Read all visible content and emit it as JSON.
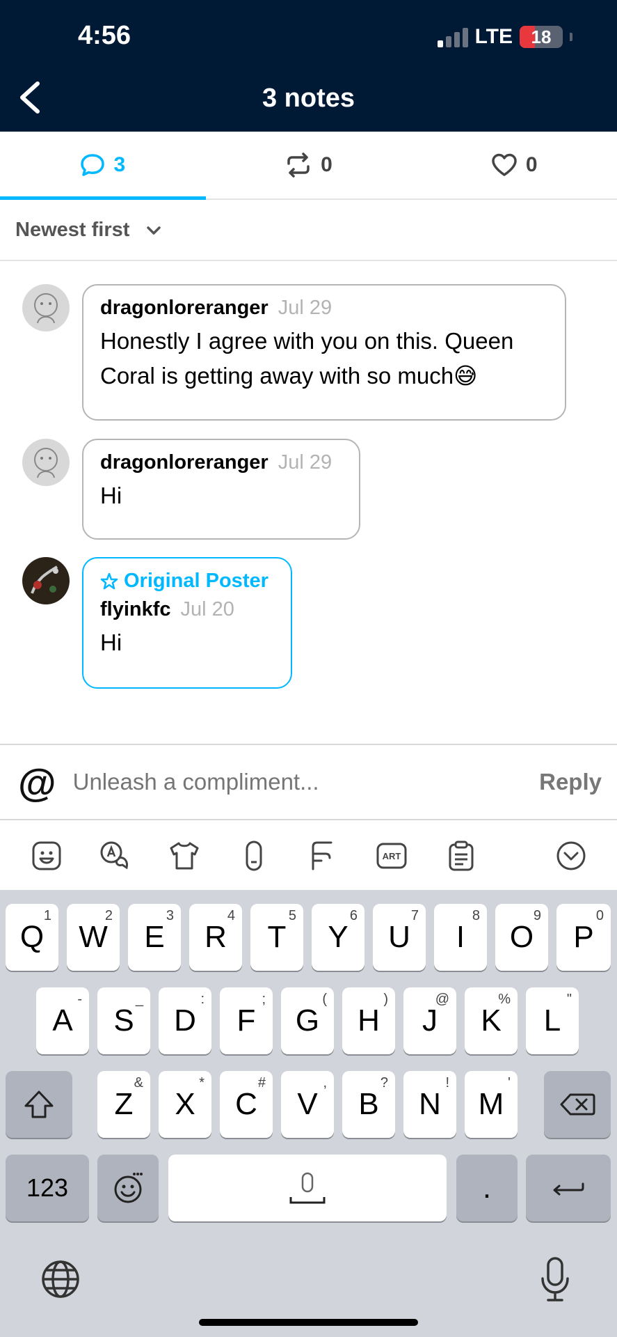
{
  "status": {
    "time": "4:56",
    "network": "LTE",
    "battery": "18"
  },
  "header": {
    "title": "3 notes"
  },
  "tabs": [
    {
      "icon": "comment-icon",
      "count": "3",
      "active": true
    },
    {
      "icon": "reblog-icon",
      "count": "0",
      "active": false
    },
    {
      "icon": "heart-icon",
      "count": "0",
      "active": false
    }
  ],
  "sort": {
    "label": "Newest first"
  },
  "notes": [
    {
      "user": "dragonloreranger",
      "date": "Jul 29",
      "text": "Honestly I agree with you on this. Queen Coral is getting away with so much😅"
    },
    {
      "user": "dragonloreranger",
      "date": "Jul 29",
      "text": "Hi"
    },
    {
      "badge": "Original Poster",
      "user": "flyinkfc",
      "date": "Jul 20",
      "text": "Hi"
    }
  ],
  "reply": {
    "at": "@",
    "placeholder": "Unleash a compliment...",
    "button": "Reply"
  },
  "keyboard": {
    "row1": [
      "Q",
      "W",
      "E",
      "R",
      "T",
      "Y",
      "U",
      "I",
      "O",
      "P"
    ],
    "row1_sup": [
      "1",
      "2",
      "3",
      "4",
      "5",
      "6",
      "7",
      "8",
      "9",
      "0"
    ],
    "row2": [
      "A",
      "S",
      "D",
      "F",
      "G",
      "H",
      "J",
      "K",
      "L"
    ],
    "row2_sup": [
      "-",
      "_",
      ":",
      ";",
      "(",
      ")",
      "@",
      "%",
      "\""
    ],
    "row3": [
      "Z",
      "X",
      "C",
      "V",
      "B",
      "N",
      "M"
    ],
    "row3_sup": [
      "&",
      "*",
      "#",
      ",",
      "?",
      "!",
      "'"
    ],
    "numbers_key": "123",
    "period_key": "."
  },
  "colors": {
    "accent": "#00b8ff",
    "header_bg": "#001935",
    "battery_low": "#e8383d"
  }
}
